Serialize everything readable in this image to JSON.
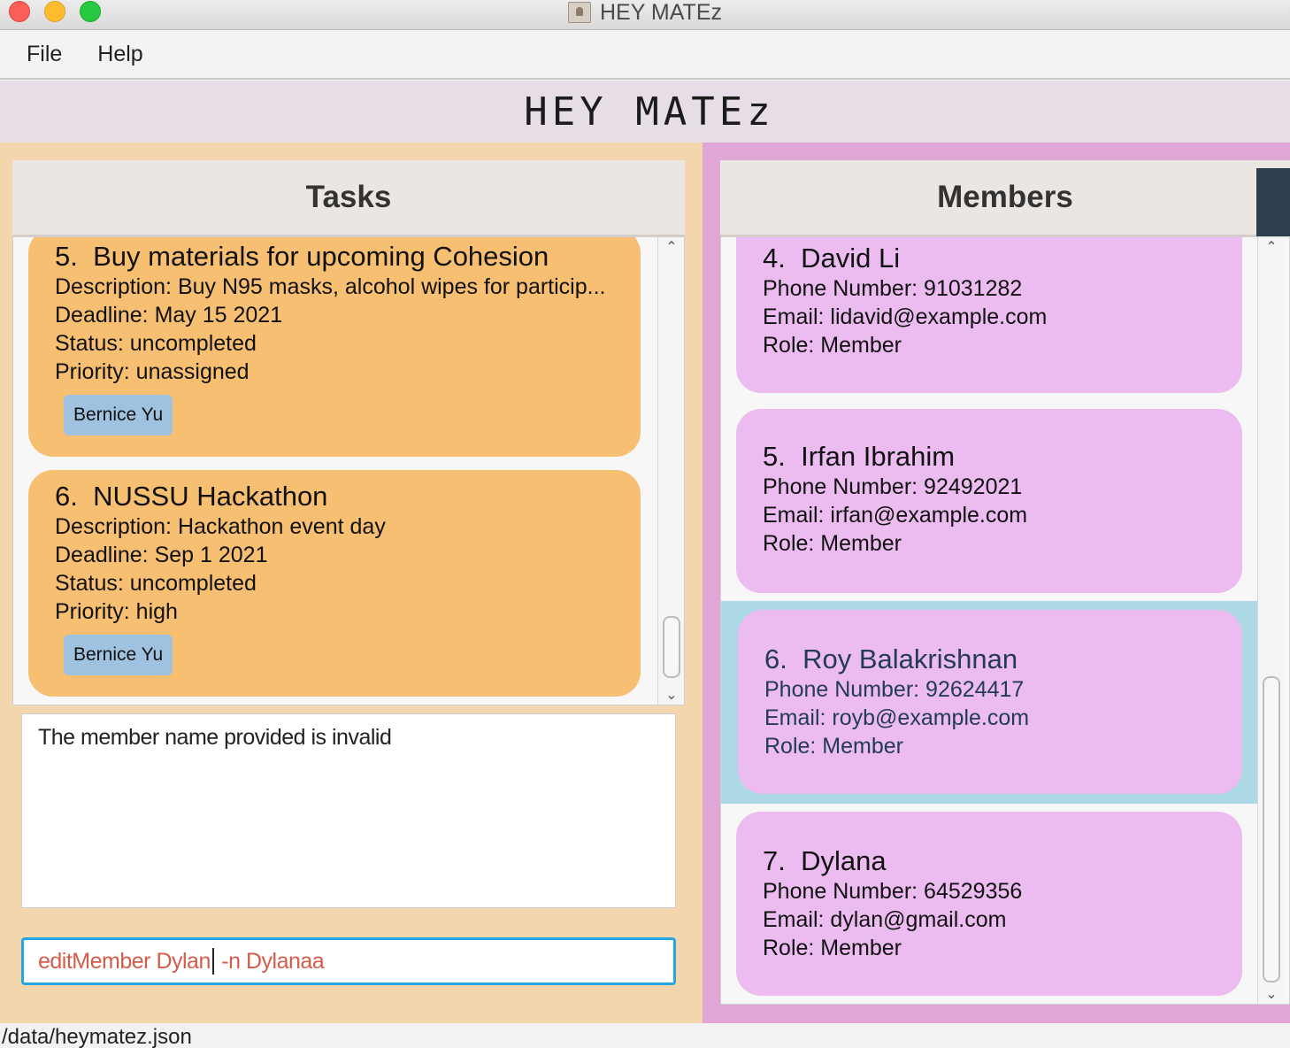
{
  "window": {
    "title": "HEY MATEz"
  },
  "menu": {
    "items": [
      "File",
      "Help"
    ]
  },
  "app": {
    "title": "HEY MATEz"
  },
  "tasks": {
    "heading": "Tasks",
    "items": [
      {
        "index": "5.",
        "name": "Buy materials for upcoming Cohesion",
        "description": "Description: Buy N95 masks, alcohol wipes for particip...",
        "deadline": "Deadline: May 15 2021",
        "status": "Status: uncompleted",
        "priority": "Priority: unassigned",
        "assignee": "Bernice Yu"
      },
      {
        "index": "6.",
        "name": "NUSSU Hackathon",
        "description": "Description: Hackathon event day",
        "deadline": "Deadline: Sep 1 2021",
        "status": "Status: uncompleted",
        "priority": "Priority: high",
        "assignee": "Bernice Yu"
      }
    ]
  },
  "result": {
    "message": "The member name provided is invalid"
  },
  "command": {
    "before_caret": "editMember Dylan",
    "after_caret": " -n Dylanaa"
  },
  "members": {
    "heading": "Members",
    "items": [
      {
        "index": "4.",
        "name": "David Li",
        "phone": "Phone Number: 91031282",
        "email": "Email: lidavid@example.com",
        "role": "Role: Member"
      },
      {
        "index": "5.",
        "name": "Irfan Ibrahim",
        "phone": "Phone Number: 92492021",
        "email": "Email: irfan@example.com",
        "role": "Role: Member"
      },
      {
        "index": "6.",
        "name": "Roy Balakrishnan",
        "phone": "Phone Number: 92624417",
        "email": "Email: royb@example.com",
        "role": "Role: Member",
        "selected": true
      },
      {
        "index": "7.",
        "name": "Dylana",
        "phone": "Phone Number: 64529356",
        "email": "Email: dylan@gmail.com",
        "role": "Role: Member"
      }
    ]
  },
  "status_bar": {
    "path": "/data/heymatez.json"
  },
  "colors": {
    "task_card": "#f6bf71",
    "member_card": "#ecbcf0",
    "selected_row": "#add8e6",
    "assignee_tag": "#9fc2e0",
    "command_text": "#d45c4b",
    "command_border": "#25a6e2"
  },
  "icons": {
    "app": "address-book-icon",
    "scroll_up": "chevron-up-icon",
    "scroll_down": "chevron-down-icon"
  }
}
